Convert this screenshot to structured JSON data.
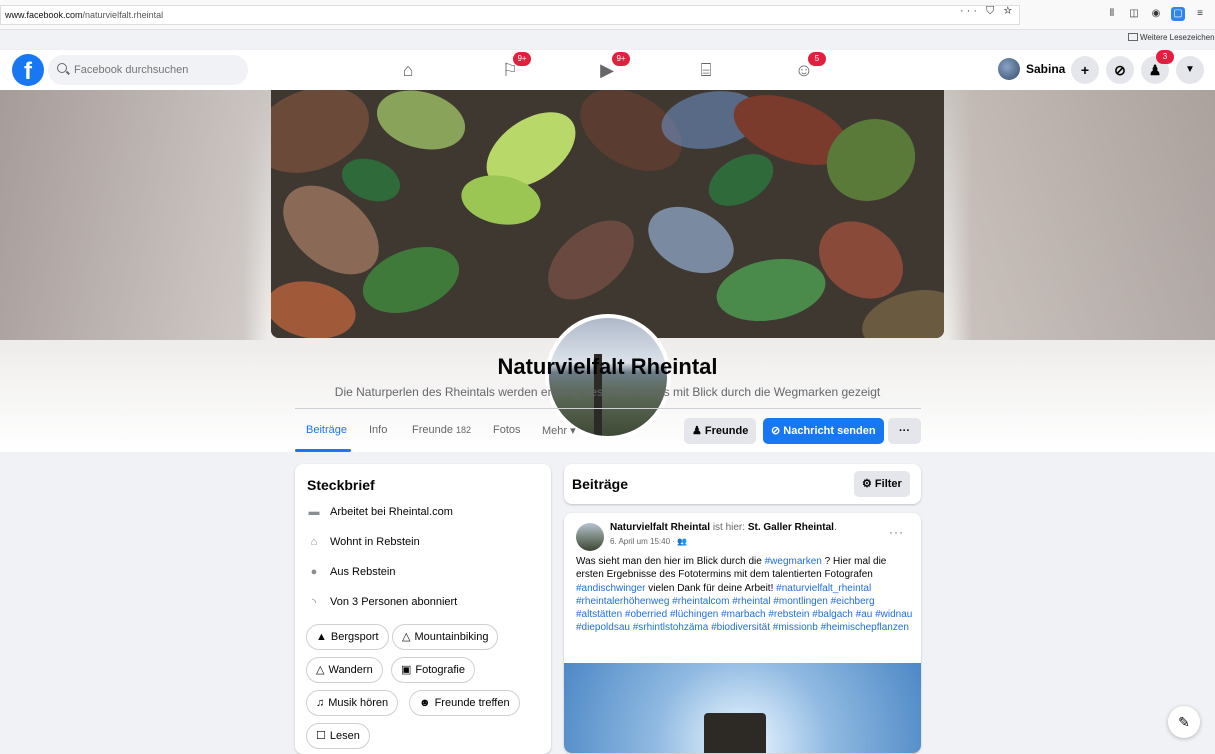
{
  "browser": {
    "url_prefix": "www.facebook.com",
    "url_path": "/naturvielfalt.rheintal",
    "page_actions": "··· ⛉ ☆",
    "bookmarks_label": "Weitere Lesezeichen"
  },
  "header": {
    "search_placeholder": "Facebook durchsuchen",
    "nav": [
      {
        "name": "home",
        "badge": ""
      },
      {
        "name": "pages",
        "badge": "9+"
      },
      {
        "name": "watch",
        "badge": "9+"
      },
      {
        "name": "marketplace",
        "badge": ""
      },
      {
        "name": "groups",
        "badge": "5"
      }
    ],
    "user_name": "Sabina",
    "notifications_badge": "3"
  },
  "profile": {
    "name": "Naturvielfalt Rheintal",
    "description": "Die Naturperlen des Rheintals werden entlang des Höhenwegs mit Blick durch die Wegmarken gezeigt",
    "tabs": {
      "posts": "Beiträge",
      "info": "Info",
      "friends": "Freunde",
      "friends_count": "182",
      "photos": "Fotos",
      "more": "Mehr ▾"
    },
    "friends_button": "Freunde",
    "message_button": "Nachricht senden",
    "more_button": "···"
  },
  "intro": {
    "title": "Steckbrief",
    "rows": [
      {
        "icon": "briefcase-icon",
        "prefix": "Arbeitet bei",
        "value": "Rheintal.com",
        "suffix": ""
      },
      {
        "icon": "home-icon",
        "prefix": "Wohnt in",
        "value": "Rebstein",
        "suffix": ""
      },
      {
        "icon": "location-pin-icon",
        "prefix": "Aus",
        "value": "Rebstein",
        "suffix": ""
      },
      {
        "icon": "rss-icon",
        "prefix": "Von",
        "value": "3 Personen",
        "suffix": "abonniert"
      }
    ],
    "hobbies": [
      "Bergsport",
      "Mountainbiking",
      "Wandern",
      "Fotografie",
      "Musik hören",
      "Freunde treffen",
      "Lesen"
    ]
  },
  "feed": {
    "title": "Beiträge",
    "filter_label": "Filter",
    "post": {
      "author": "Naturvielfalt Rheintal",
      "location_prefix": "ist hier:",
      "location": "St. Galler Rheintal",
      "date": "6. April um 15:40 ·",
      "text_intro": "Was sieht man den hier im Blick durch die",
      "hashtag_wegmarken": "#wegmarken",
      "text_mid": "? Hier mal die ersten Ergebnisse des Fototermins mit dem talentierten Fotografen",
      "hashtag_photographer": "#andischwinger",
      "text_thanks": "vielen Dank für deine Arbeit!",
      "hashtags": "#naturvielfalt_rheintal #rheintalerhöhenweg #rheintalcom #rheintal #montlingen #eichberg #altstätten #oberried #lüchingen #marbach #rebstein #balgach #au #widnau #diepoldsau #srhintlstohzäma #biodiversität #missionb #heimischepflanzen"
    }
  },
  "colors": {
    "brand": "#1877f2",
    "badge": "#e41e3f",
    "page_bg": "#f0f2f5"
  }
}
